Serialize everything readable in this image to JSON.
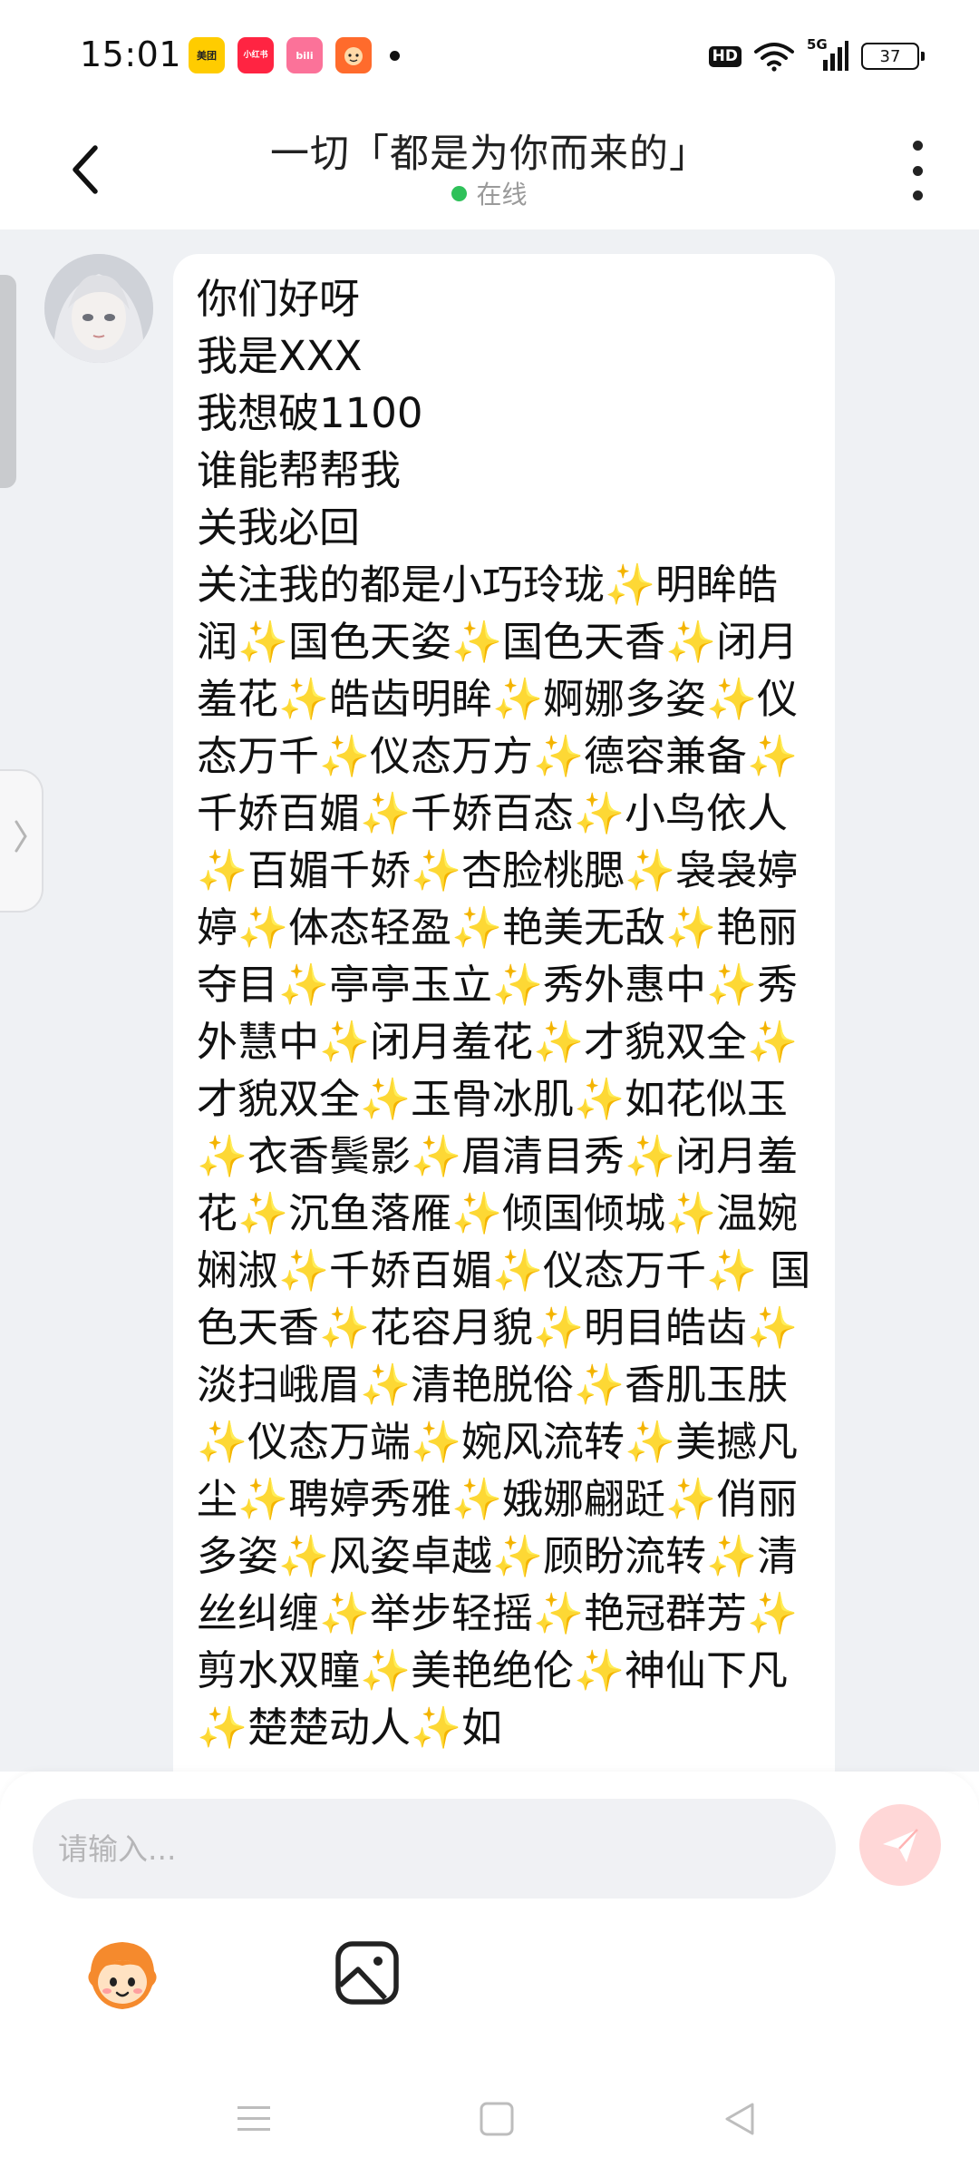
{
  "status_bar": {
    "time": "15:01",
    "app_icons": [
      {
        "name": "meituan-icon",
        "label": "美团",
        "color": "#ffcc00"
      },
      {
        "name": "xiaohongshu-icon",
        "label": "小红书",
        "color": "#ff2442"
      },
      {
        "name": "bilibili-icon",
        "label": "bili",
        "color": "#fb7299"
      },
      {
        "name": "app-icon",
        "label": "",
        "color": "#ff6b2c"
      }
    ],
    "hd_label": "HD",
    "network_label": "5G",
    "battery": "37"
  },
  "header": {
    "title": "一切「都是为你而来的」",
    "status": "在线",
    "status_color": "#2fc15a"
  },
  "message": {
    "text": "你们好呀\n我是XXX\n我想破1100\n谁能帮帮我\n关我必回\n关注我的都是小巧玲珑✨明眸皓润✨国色天姿✨国色天香✨闭月羞花✨皓齿明眸✨婀娜多姿✨仪态万千✨仪态万方✨德容兼备✨千娇百媚✨千娇百态✨小鸟依人✨百媚千娇✨杏脸桃腮✨袅袅婷婷✨体态轻盈✨艳美无敌✨艳丽夺目✨亭亭玉立✨秀外惠中✨秀外慧中✨闭月羞花✨才貌双全✨才貌双全✨玉骨冰肌✨如花似玉✨衣香鬓影✨眉清目秀✨闭月羞花✨沉鱼落雁✨倾国倾城✨温婉娴淑✨千娇百媚✨仪态万千✨ 国色天香✨花容月貌✨明目皓齿✨淡扫峨眉✨清艳脱俗✨香肌玉肤✨仪态万端✨婉风流转✨美撼凡尘✨聘婷秀雅✨娥娜翩跹✨俏丽多姿✨风姿卓越✨顾盼流转✨清丝纠缠✨举步轻摇✨艳冠群芳✨剪水双瞳✨美艳绝伦✨神仙下凡✨楚楚动人✨如"
  },
  "composer": {
    "placeholder": "请输入...",
    "value": "",
    "send_color": "#ff5a5a"
  }
}
